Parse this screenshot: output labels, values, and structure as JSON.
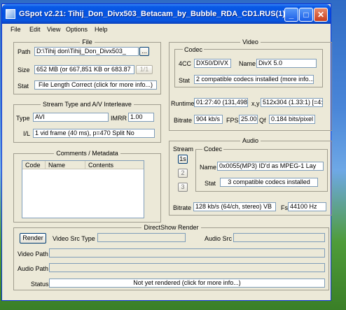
{
  "window": {
    "title": "GSpot v2.21: Tihij_Don_Divx503_Betacam_by_Bubble_RDA_CD1.RUS(1)",
    "minimize_glyph": "_",
    "maximize_glyph": "□",
    "close_glyph": "✕"
  },
  "menu": [
    "File",
    "Edit",
    "View",
    "Options",
    "Help"
  ],
  "file": {
    "title": "File",
    "path_label": "Path",
    "path_value": "D:\\Tihij don\\Tihij_Don_Divx503_",
    "browse_label": "...",
    "size_label": "Size",
    "size_value": "652 MB (or 667,851 KB or 683.87",
    "size_button": "1/1",
    "stat_label": "Stat",
    "stat_value": "File Length Correct (click for more info...)"
  },
  "stream": {
    "title": "Stream Type and A/V Interleave",
    "type_label": "Type",
    "type_value": "AVI",
    "imrr_label": "IMRR",
    "imrr_value": "1.00",
    "il_label": "I/L",
    "il_value": "1 vid frame (40 ms), p=470  Split  No"
  },
  "comments": {
    "title": "Comments / Metadata",
    "columns": [
      "Code",
      "Name",
      "Contents"
    ]
  },
  "video": {
    "title": "Video",
    "codec_title": "Codec",
    "fourcc_label": "4CC",
    "fourcc_value": "DX50/DIVX",
    "name_label": "Name",
    "name_value": "DivX 5.0",
    "stat_label": "Stat",
    "stat_value": "2 compatible codecs installed (more info...)",
    "runtime_label": "Runtime",
    "runtime_value": "01:27:40 (131,498",
    "xy_label": "x,y",
    "xy_value": "512x304 (1.33:1) [=4:",
    "bitrate_label": "Bitrate",
    "bitrate_value": "904 kb/s",
    "fps_label": "FPS",
    "fps_value": "25.00",
    "qf_label": "Qf",
    "qf_value": "0.184 bits/pixel"
  },
  "audio": {
    "title": "Audio",
    "stream_title": "Stream",
    "streams": [
      "1s",
      "2",
      "3"
    ],
    "codec_title": "Codec",
    "name_label": "Name",
    "name_value": "0x0055(MP3) ID'd as MPEG-1 Lay",
    "stat_label": "Stat",
    "stat_value": "3 compatible codecs installed",
    "bitrate_label": "Bitrate",
    "bitrate_value": "128 kb/s (64/ch, stereo) VB",
    "fs_label": "Fs",
    "fs_value": "44100 Hz"
  },
  "directshow": {
    "title": "DirectShow Render",
    "render_button": "Render",
    "video_src_label": "Video Src Type",
    "audio_src_label": "Audio Src",
    "video_path_label": "Video Path",
    "audio_path_label": "Audio Path",
    "status_label": "Status",
    "status_value": "Not yet rendered (click for more info...)"
  }
}
